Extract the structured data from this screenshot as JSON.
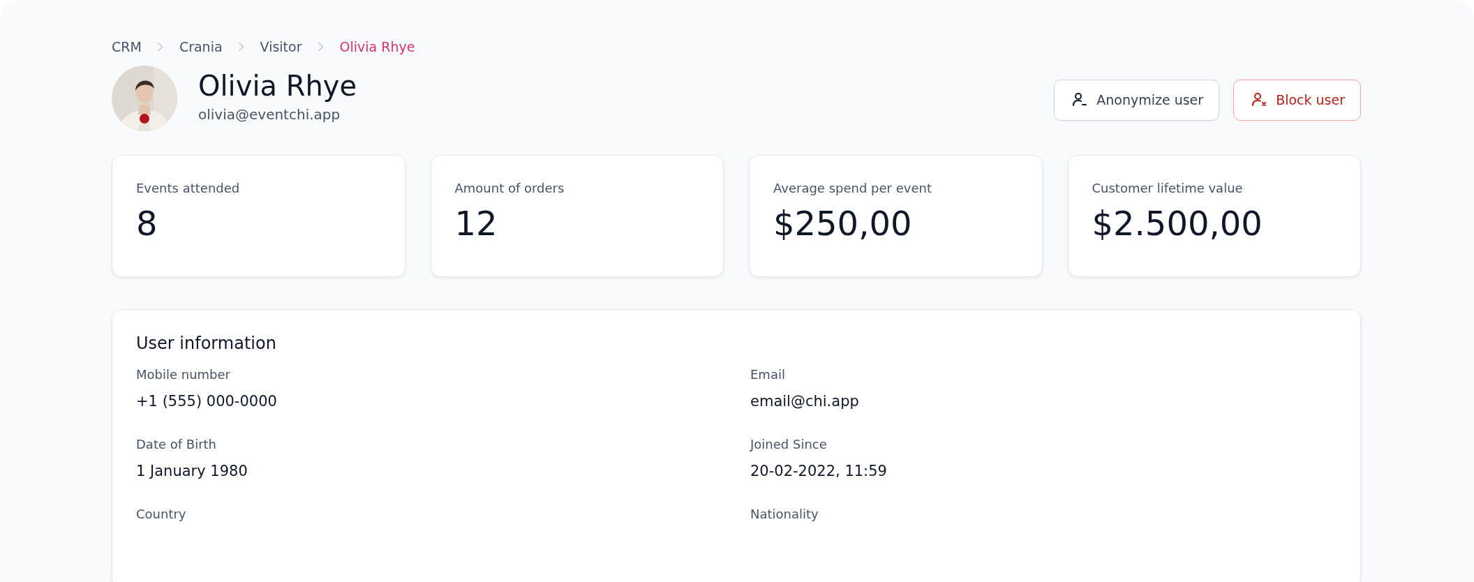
{
  "breadcrumb": [
    {
      "label": "CRM",
      "current": false
    },
    {
      "label": "Crania",
      "current": false
    },
    {
      "label": "Visitor",
      "current": false
    },
    {
      "label": "Olivia Rhye",
      "current": true
    }
  ],
  "profile": {
    "name": "Olivia Rhye",
    "email": "olivia@eventchi.app"
  },
  "actions": [
    {
      "label": "Anonymize user",
      "kind": "neutral"
    },
    {
      "label": "Block user",
      "kind": "danger"
    }
  ],
  "stats": [
    {
      "label": "Events attended",
      "value": "8"
    },
    {
      "label": "Amount of orders",
      "value": "12"
    },
    {
      "label": "Average spend per event",
      "value": "$250,00"
    },
    {
      "label": "Customer lifetime value",
      "value": "$2.500,00"
    }
  ],
  "user_information": {
    "title": "User information",
    "fields": [
      {
        "label": "Mobile number",
        "value": "+1 (555) 000-0000"
      },
      {
        "label": "Email",
        "value": "email@chi.app"
      },
      {
        "label": "Date of Birth",
        "value": "1 January 1980"
      },
      {
        "label": "Joined Since",
        "value": "20-02-2022, 11:59"
      },
      {
        "label": "Country"
      },
      {
        "label": "Nationality"
      }
    ]
  }
}
